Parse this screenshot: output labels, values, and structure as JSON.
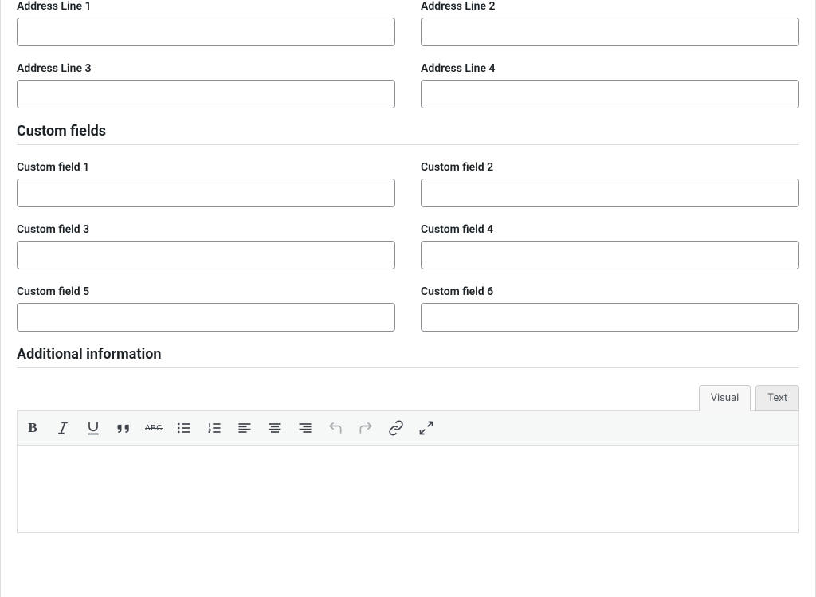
{
  "top_fields": [
    {
      "label": "Address Line 1",
      "value": "",
      "name": "address-line-1"
    },
    {
      "label": "Address Line 2",
      "value": "",
      "name": "address-line-2"
    },
    {
      "label": "Address Line 3",
      "value": "",
      "name": "address-line-3"
    },
    {
      "label": "Address Line 4",
      "value": "",
      "name": "address-line-4"
    }
  ],
  "sections": {
    "custom_fields_title": "Custom fields",
    "additional_info_title": "Additional information"
  },
  "custom_fields": [
    {
      "label": "Custom field 1",
      "value": "",
      "name": "custom-field-1"
    },
    {
      "label": "Custom field 2",
      "value": "",
      "name": "custom-field-2"
    },
    {
      "label": "Custom field 3",
      "value": "",
      "name": "custom-field-3"
    },
    {
      "label": "Custom field 4",
      "value": "",
      "name": "custom-field-4"
    },
    {
      "label": "Custom field 5",
      "value": "",
      "name": "custom-field-5"
    },
    {
      "label": "Custom field 6",
      "value": "",
      "name": "custom-field-6"
    }
  ],
  "editor": {
    "tabs": {
      "visual": "Visual",
      "text": "Text",
      "active": "visual"
    },
    "content": "",
    "tools": {
      "bold": "B",
      "strike": "ABC"
    }
  }
}
